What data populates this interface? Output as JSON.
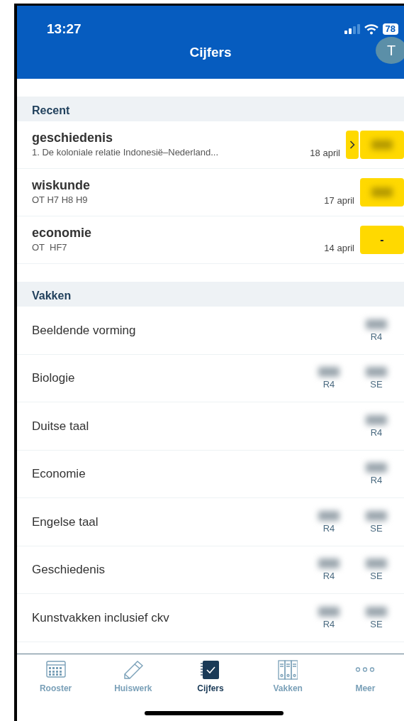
{
  "status_bar": {
    "time": "13:27",
    "battery": "78"
  },
  "header": {
    "title": "Cijfers",
    "avatar_initial": "T"
  },
  "recent": {
    "heading": "Recent",
    "items": [
      {
        "subject": "geschiedenis",
        "description": "1. De koloniale relatie Indonesië–Nederland...",
        "date": "18 april",
        "has_arrow": true,
        "grade_hidden": true
      },
      {
        "subject": "wiskunde",
        "description": "OT H7 H8 H9",
        "date": "17 april",
        "has_arrow": false,
        "grade_hidden": true
      },
      {
        "subject": "economie",
        "description": "OT  HF7",
        "date": "14 april",
        "has_arrow": false,
        "grade_hidden": false,
        "grade": "-"
      }
    ]
  },
  "subjects": {
    "heading": "Vakken",
    "items": [
      {
        "name": "Beeldende vorming",
        "grades": [
          {
            "label": "R4"
          }
        ]
      },
      {
        "name": "Biologie",
        "grades": [
          {
            "label": "R4"
          },
          {
            "label": "SE"
          }
        ]
      },
      {
        "name": "Duitse taal",
        "grades": [
          {
            "label": "R4"
          }
        ]
      },
      {
        "name": "Economie",
        "grades": [
          {
            "label": "R4"
          }
        ]
      },
      {
        "name": "Engelse taal",
        "grades": [
          {
            "label": "R4"
          },
          {
            "label": "SE"
          }
        ]
      },
      {
        "name": "Geschiedenis",
        "grades": [
          {
            "label": "R4"
          },
          {
            "label": "SE"
          }
        ]
      },
      {
        "name": "Kunstvakken inclusief ckv",
        "grades": [
          {
            "label": "R4"
          },
          {
            "label": "SE"
          }
        ]
      }
    ]
  },
  "tabs": [
    {
      "label": "Rooster",
      "kind": "calendar",
      "selected": false
    },
    {
      "label": "Huiswerk",
      "kind": "pencil",
      "selected": false
    },
    {
      "label": "Cijfers",
      "kind": "notebook",
      "selected": true
    },
    {
      "label": "Vakken",
      "kind": "binders",
      "selected": false
    },
    {
      "label": "Meer",
      "kind": "dots",
      "selected": false
    }
  ]
}
